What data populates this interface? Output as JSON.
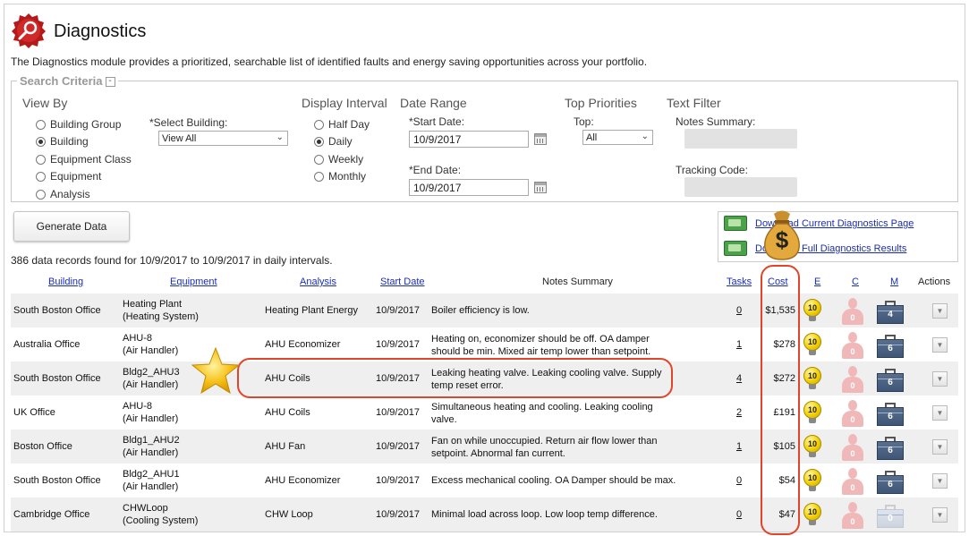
{
  "header": {
    "title": "Diagnostics",
    "description": "The Diagnostics module provides a prioritized, searchable list of identified faults and energy saving opportunities across your portfolio."
  },
  "criteria": {
    "legend": "Search Criteria",
    "toggle": "-",
    "view_by": {
      "label": "View By",
      "options": [
        "Building Group",
        "Building",
        "Equipment Class",
        "Equipment",
        "Analysis"
      ],
      "selected": "Building"
    },
    "select_building": {
      "label": "*Select Building:",
      "value": "View All"
    },
    "display_interval": {
      "label": "Display Interval",
      "options": [
        "Half Day",
        "Daily",
        "Weekly",
        "Monthly"
      ],
      "selected": "Daily"
    },
    "date_range": {
      "label": "Date Range",
      "start_label": "*Start Date:",
      "start_value": "10/9/2017",
      "end_label": "*End Date:",
      "end_value": "10/9/2017"
    },
    "top_priorities": {
      "label": "Top Priorities",
      "top_label": "Top:",
      "top_value": "All"
    },
    "text_filter": {
      "label": "Text Filter",
      "notes_label": "Notes Summary:",
      "tracking_label": "Tracking Code:"
    }
  },
  "generate_button": "Generate Data",
  "downloads": {
    "link1": "Download Current Diagnostics Page",
    "link2": "Download Full Diagnostics Results"
  },
  "records_text": "386 data records found for 10/9/2017 to 10/9/2017 in daily intervals.",
  "columns": {
    "building": "Building",
    "equipment": "Equipment",
    "analysis": "Analysis",
    "start_date": "Start Date",
    "notes": "Notes Summary",
    "tasks": "Tasks",
    "cost": "Cost",
    "e": "E",
    "c": "C",
    "m": "M",
    "actions": "Actions"
  },
  "rows": [
    {
      "building": "South Boston Office",
      "equip1": "Heating Plant",
      "equip2": "(Heating System)",
      "analysis": "Heating Plant Energy",
      "date": "10/9/2017",
      "notes1": "Boiler efficiency is low.",
      "notes2": "",
      "tasks": "0",
      "cost": "$1,535",
      "e": "10",
      "c": "0",
      "m": "4",
      "m_faded": false
    },
    {
      "building": "Australia Office",
      "equip1": "AHU-8",
      "equip2": "(Air Handler)",
      "analysis": "AHU Economizer",
      "date": "10/9/2017",
      "notes1": "Heating on, economizer should be off. OA damper",
      "notes2": "should be min. Mixed air temp lower than setpoint.",
      "tasks": "1",
      "cost": "$278",
      "e": "10",
      "c": "0",
      "m": "6",
      "m_faded": false
    },
    {
      "building": "South Boston Office",
      "equip1": "Bldg2_AHU3",
      "equip2": "(Air Handler)",
      "analysis": "AHU Coils",
      "date": "10/9/2017",
      "notes1": "Leaking heating valve. Leaking cooling valve. Supply",
      "notes2": "temp reset error.",
      "tasks": "4",
      "cost": "$272",
      "e": "10",
      "c": "0",
      "m": "6",
      "m_faded": false
    },
    {
      "building": "UK Office",
      "equip1": "AHU-8",
      "equip2": "(Air Handler)",
      "analysis": "AHU Coils",
      "date": "10/9/2017",
      "notes1": "Simultaneous heating and cooling. Leaking cooling",
      "notes2": "valve.",
      "tasks": "2",
      "cost": "£191",
      "e": "10",
      "c": "0",
      "m": "6",
      "m_faded": false
    },
    {
      "building": "Boston Office",
      "equip1": "Bldg1_AHU2",
      "equip2": "(Air Handler)",
      "analysis": "AHU Fan",
      "date": "10/9/2017",
      "notes1": "Fan on while unoccupied. Return air flow lower than",
      "notes2": "setpoint. Abnormal fan current.",
      "tasks": "1",
      "cost": "$105",
      "e": "10",
      "c": "0",
      "m": "6",
      "m_faded": false
    },
    {
      "building": "South Boston Office",
      "equip1": "Bldg2_AHU1",
      "equip2": "(Air Handler)",
      "analysis": "AHU Economizer",
      "date": "10/9/2017",
      "notes1": "Excess mechanical cooling. OA Damper should be max.",
      "notes2": "",
      "tasks": "0",
      "cost": "$54",
      "e": "10",
      "c": "0",
      "m": "6",
      "m_faded": false
    },
    {
      "building": "Cambridge Office",
      "equip1": "CHWLoop",
      "equip2": "(Cooling System)",
      "analysis": "CHW Loop",
      "date": "10/9/2017",
      "notes1": "Minimal load across loop. Low loop temp difference.",
      "notes2": "",
      "tasks": "0",
      "cost": "$47",
      "e": "10",
      "c": "0",
      "m": "0",
      "m_faded": true
    }
  ],
  "overlay_money": "$"
}
